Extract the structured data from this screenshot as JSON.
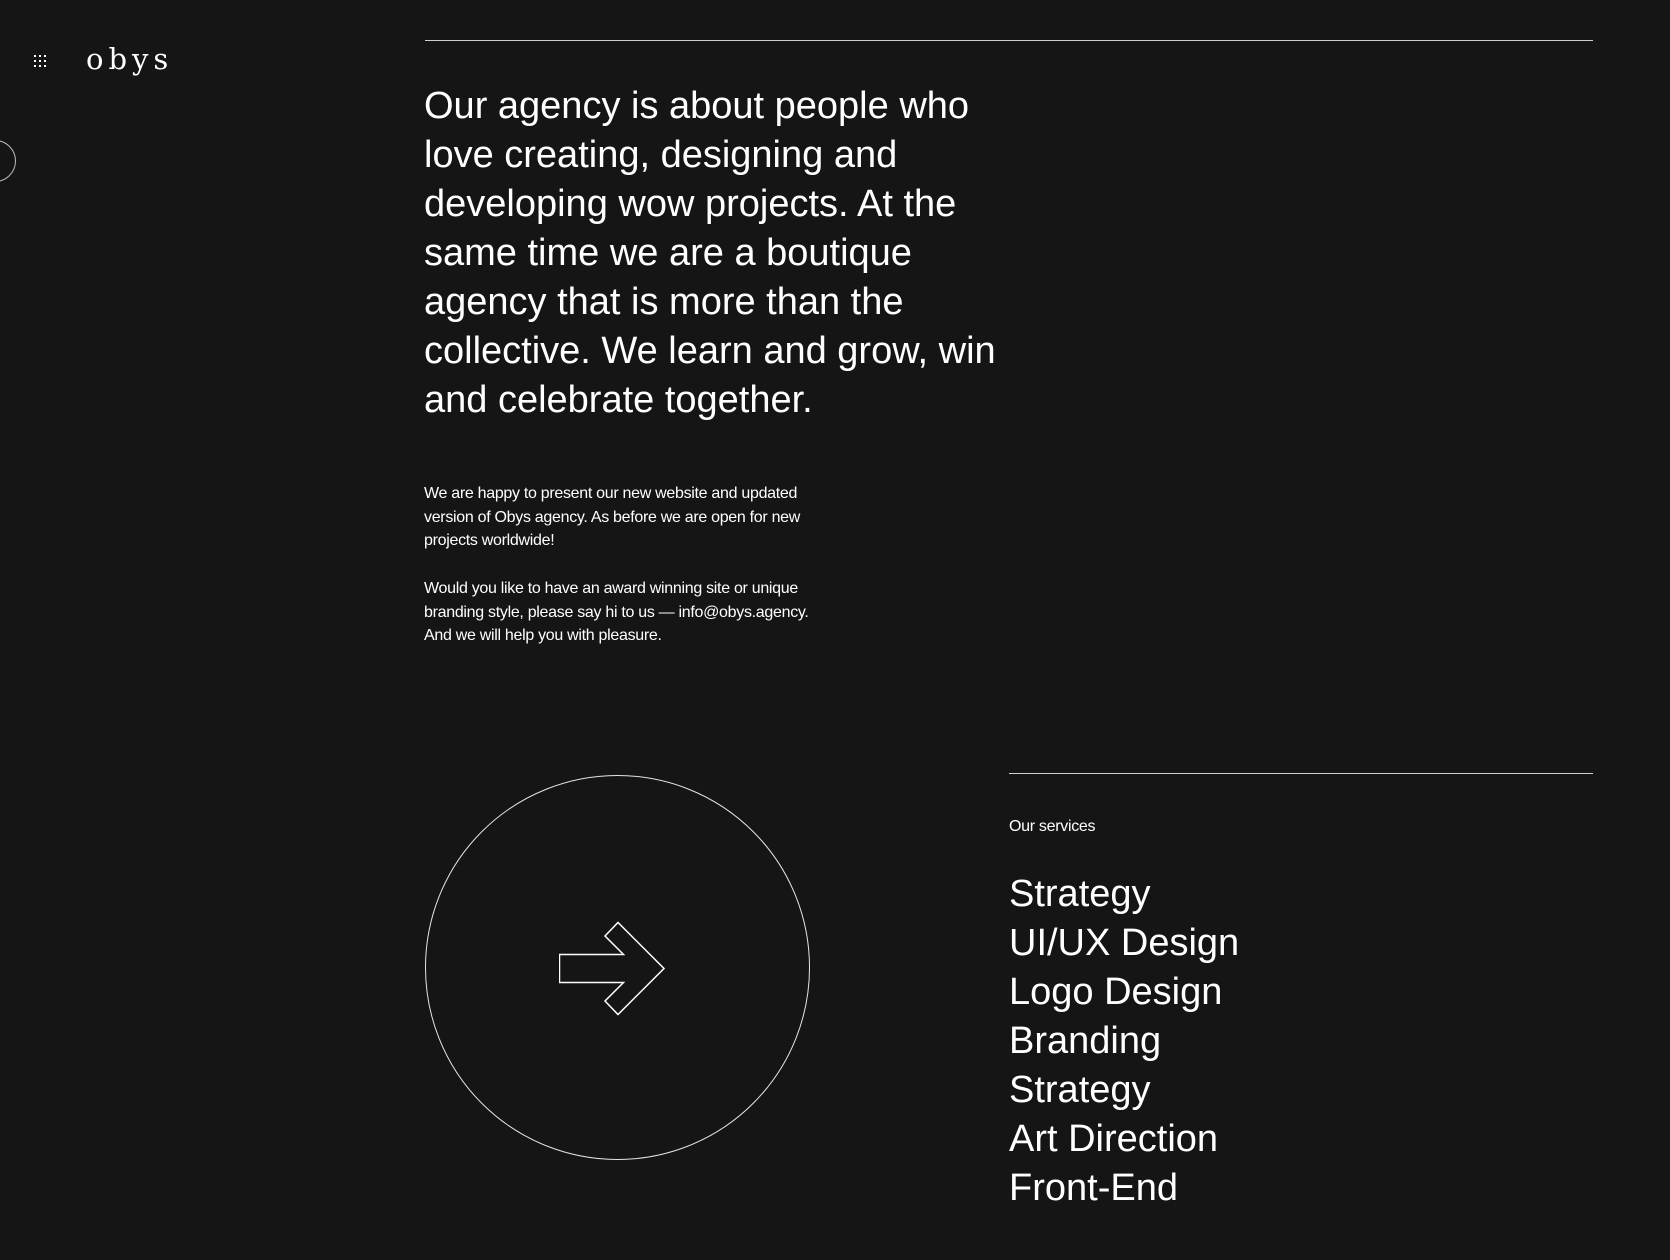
{
  "header": {
    "logo_text": "obys",
    "menu_icon": "grid-dots-icon"
  },
  "intro": {
    "headline": "Our agency is about people who love creating, designing and developing wow projects. At the same time we are a boutique agency that is more than the collective. We learn and grow, win and celebrate together.",
    "paragraph_1": "We are happy to present our new website and updated version of Obys agency. As before we are open for new projects worldwide!",
    "paragraph_2": "Would you like to have an award winning site or unique branding style, please say hi to us — info@obys.agency. And we will help you with pleasure."
  },
  "cta": {
    "icon": "arrow-right-icon"
  },
  "services": {
    "label": "Our services",
    "items": [
      "Strategy",
      "UI/UX Design",
      "Logo Design",
      "Branding",
      "Strategy",
      "Art Direction",
      "Front-End"
    ]
  },
  "colors": {
    "background": "#151515",
    "text": "#ffffff",
    "rule": "#cfcfcf"
  }
}
